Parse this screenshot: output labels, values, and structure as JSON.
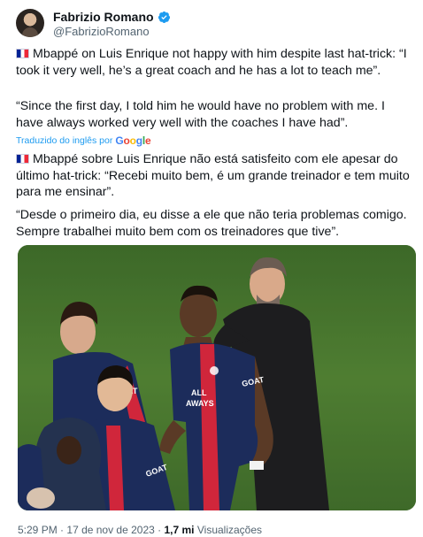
{
  "tweet": {
    "author_name": "Fabrizio Romano",
    "author_handle": "@FabrizioRomano",
    "verified_icon": "verified-badge-icon",
    "more_icon": "ellipsis",
    "paragraph1": "Mbappé on Luis Enrique not happy with him despite last hat-trick: “I took it very well, he’s a great coach and he has a lot to teach me”.",
    "paragraph2": "“Since the first day, I told him he would have no problem with me. I have always worked very well with the coaches I have had”.",
    "translated_label": "Traduzido do inglês por",
    "translated_by": "Google",
    "paragraph3": "Mbappé sobre Luis Enrique não está satisfeito com ele apesar do último hat-trick: “Recebi muito bem, é um grande treinador e tem muito para me ensinar”.",
    "paragraph4": "“Desde o primeiro dia, eu disse a ele que não teria problemas comigo. Sempre trabalhei muito bem com os treinadores que tive”.",
    "time": "5:29 PM",
    "separator": "·",
    "date": "17 de nov de 2023",
    "views_count": "1,7 mi",
    "views_label": "Visualizações",
    "photo": {
      "sponsor_text": "GOAT",
      "sponsor_text_2": "GOAT",
      "sponsor_text_3": "GOAT",
      "shirt_text": "ALL\nAWAYS"
    }
  },
  "colors": {
    "link_blue": "#1d9bf0",
    "secondary_text": "#536471",
    "pitch_green": "#4f7f33",
    "psg_navy": "#1c2c5b",
    "psg_red": "#d0263b"
  }
}
